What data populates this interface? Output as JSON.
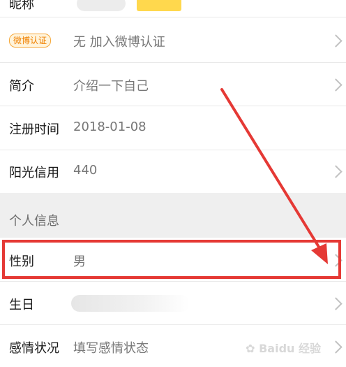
{
  "rows": {
    "nickname": {
      "label": "昵称"
    },
    "weibo_verify": {
      "badge": "微博认证",
      "value": "无 加入微博认证"
    },
    "intro": {
      "label": "简介",
      "value": "介绍一下自己"
    },
    "register_time": {
      "label": "注册时间",
      "value": "2018-01-08"
    },
    "sunshine_credit": {
      "label": "阳光信用",
      "value": "440"
    },
    "gender": {
      "label": "性别",
      "value": "男"
    },
    "birthday": {
      "label": "生日"
    },
    "relationship": {
      "label": "感情状况",
      "value": "填写感情状态"
    }
  },
  "section": {
    "personal_info": "个人信息"
  },
  "watermark": {
    "text": "Baidu 经验"
  },
  "colors": {
    "highlight": "#e53935",
    "arrow": "#e53935",
    "badge": "#f08000"
  }
}
